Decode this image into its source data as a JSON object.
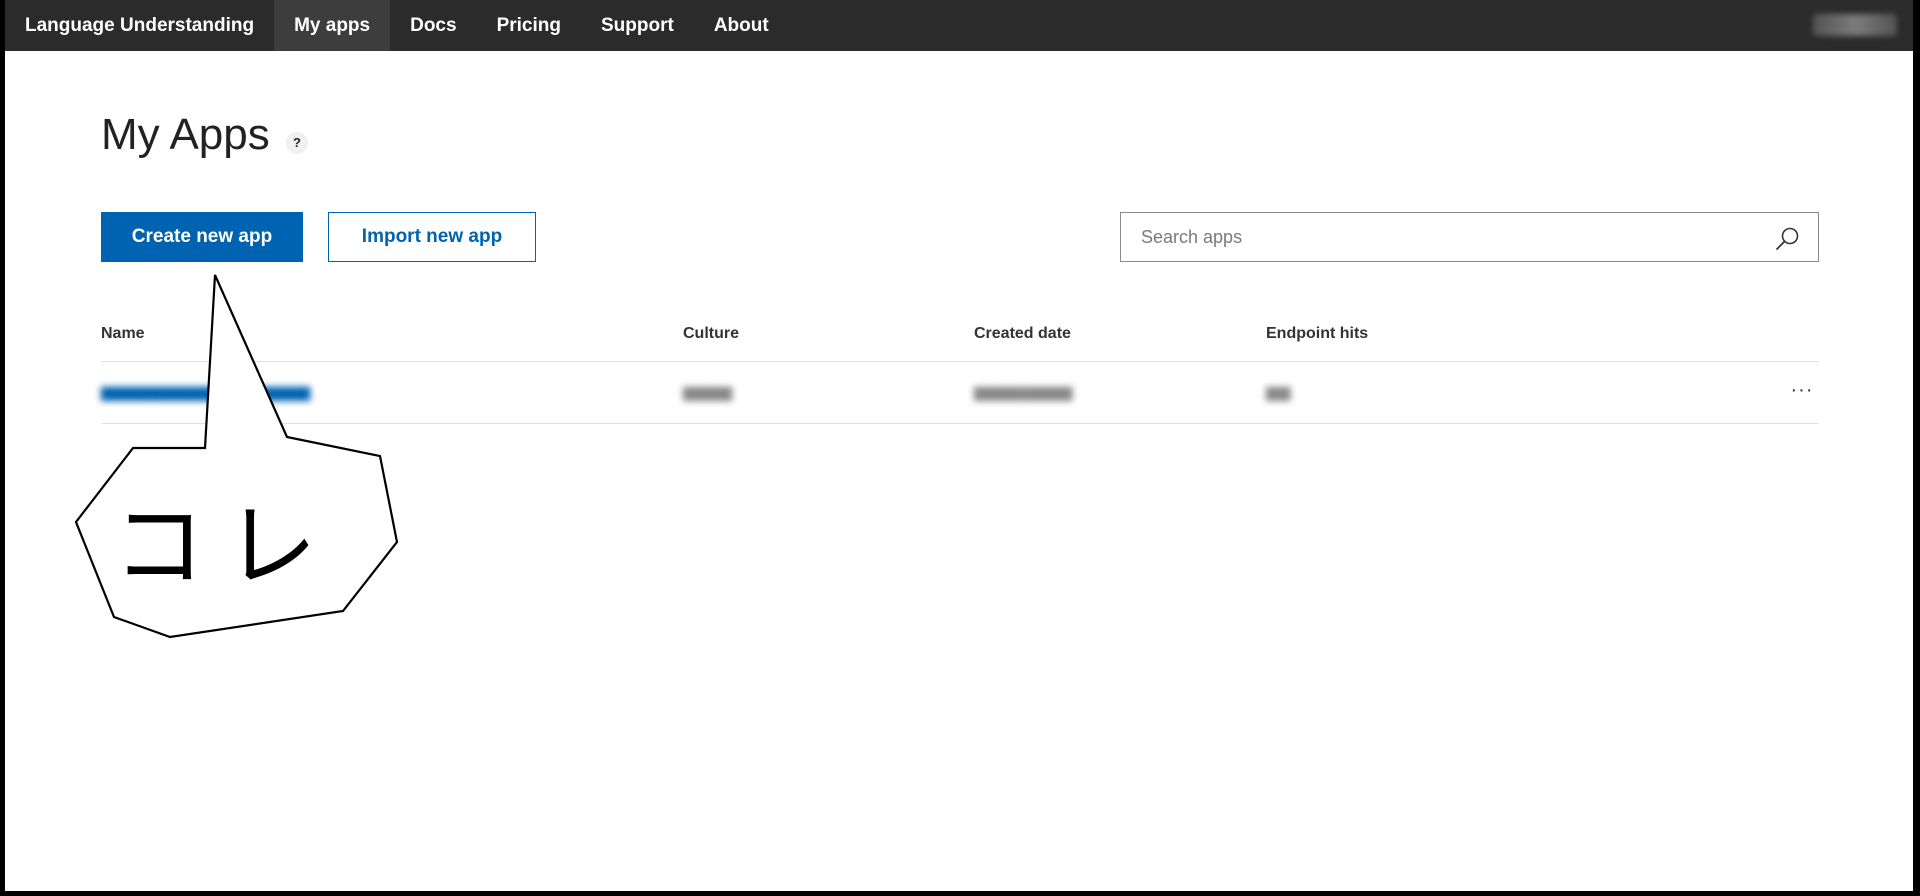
{
  "nav": {
    "items": [
      {
        "label": "Language Understanding",
        "active": false
      },
      {
        "label": "My apps",
        "active": true
      },
      {
        "label": "Docs",
        "active": false
      },
      {
        "label": "Pricing",
        "active": false
      },
      {
        "label": "Support",
        "active": false
      },
      {
        "label": "About",
        "active": false
      }
    ]
  },
  "page": {
    "title": "My Apps",
    "help_label": "?"
  },
  "actions": {
    "create_label": "Create new app",
    "import_label": "Import new app"
  },
  "search": {
    "placeholder": "Search apps",
    "value": ""
  },
  "table": {
    "columns": [
      "Name",
      "Culture",
      "Created date",
      "Endpoint hits"
    ],
    "rows": [
      {
        "name": "",
        "culture": "",
        "created": "",
        "hits": ""
      }
    ],
    "more_label": "···"
  },
  "annotation": {
    "text": "コレ"
  },
  "colors": {
    "accent": "#0063b1",
    "nav_bg": "#2b2b2b"
  }
}
